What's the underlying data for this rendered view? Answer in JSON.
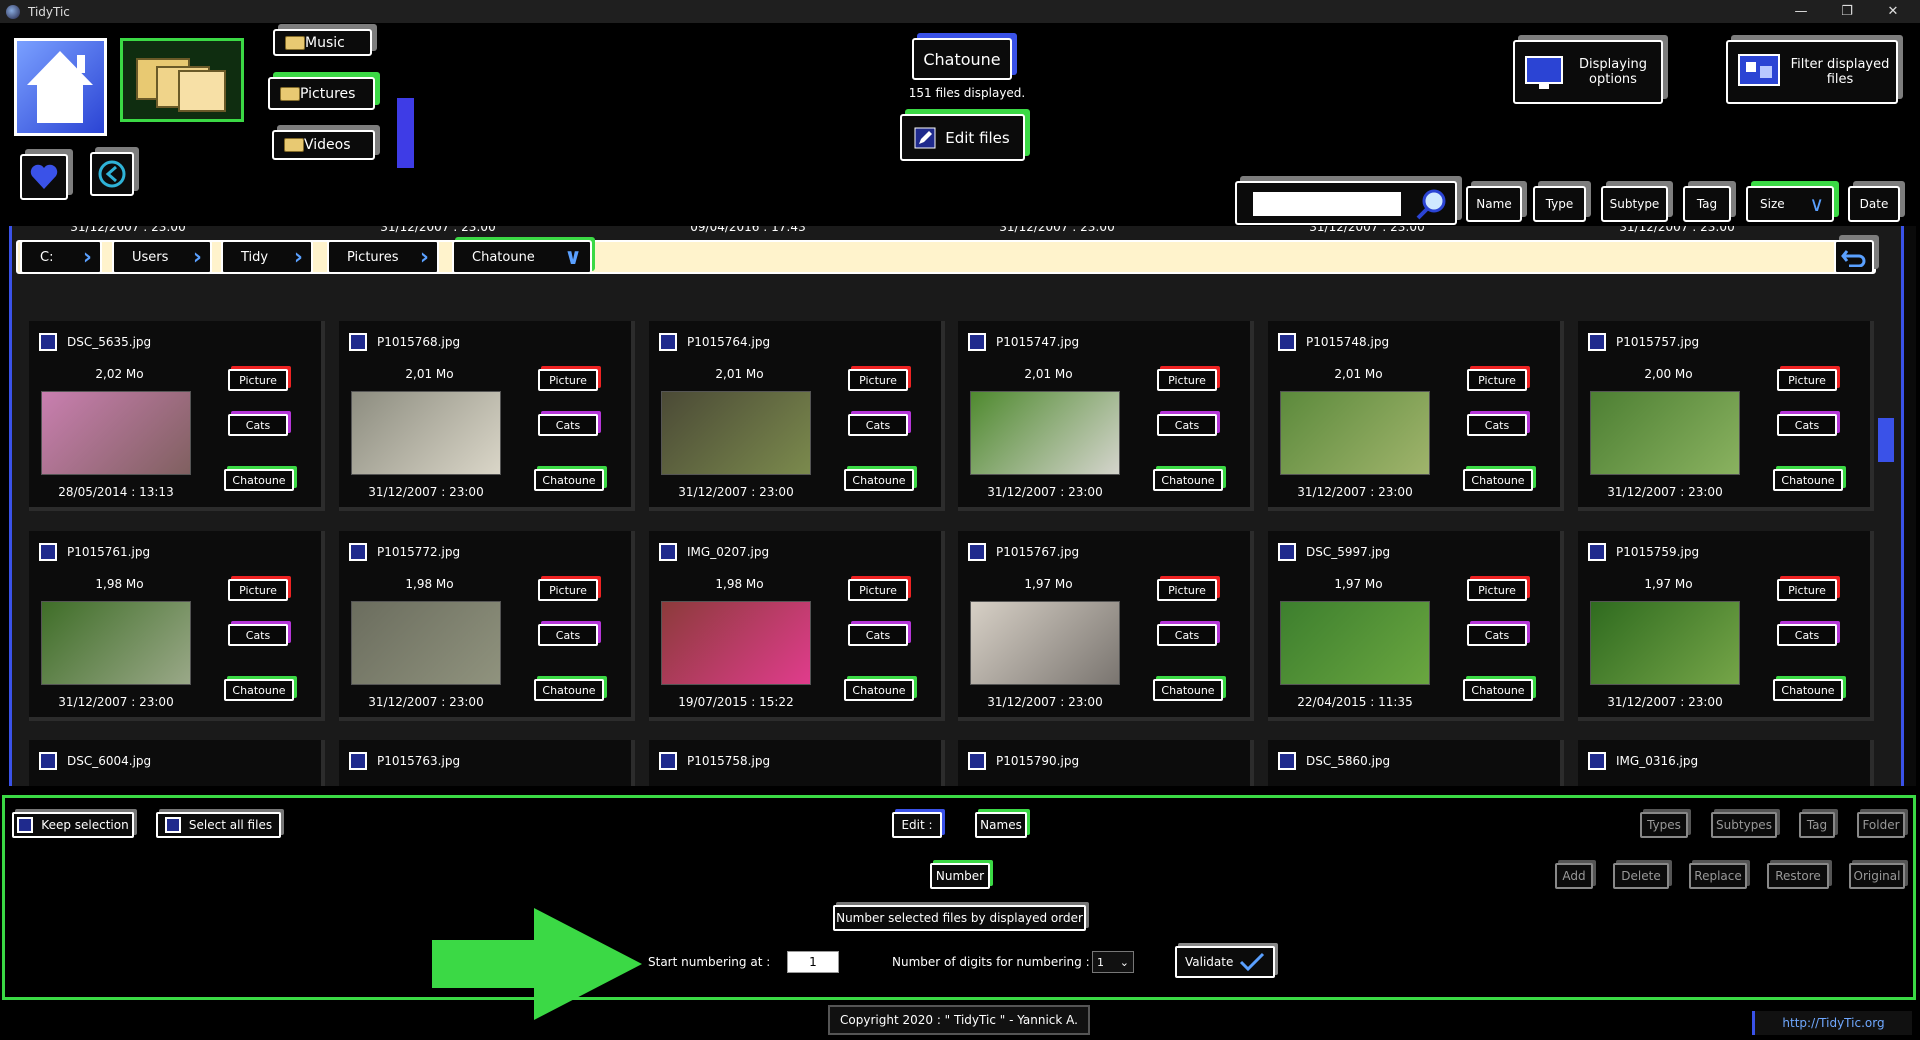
{
  "app": {
    "title": "TidyTic"
  },
  "window_controls": {
    "minimize": "—",
    "maximize": "❐",
    "close": "✕"
  },
  "nav": {
    "music": "Music",
    "pictures": "Pictures",
    "videos": "Videos"
  },
  "current_folder": {
    "name": "Chatoune",
    "count_label": "151 files displayed.",
    "edit_label": "Edit files"
  },
  "options": {
    "display": "Displaying options",
    "filter": "Filter displayed files"
  },
  "search": {
    "value": ""
  },
  "sort": {
    "name": "Name",
    "type": "Type",
    "subtype": "Subtype",
    "tag": "Tag",
    "size": "Size",
    "date": "Date"
  },
  "breadcrumb": [
    "C:",
    "Users",
    "Tidy",
    "Pictures",
    "Chatoune"
  ],
  "top_partial_dates": [
    "31/12/2007 : 23:00",
    "31/12/2007 : 23:00",
    "09/04/2016 : 17:43",
    "31/12/2007 : 23:00",
    "31/12/2007 : 23:00",
    "31/12/2007 : 23:00"
  ],
  "files_row1": [
    {
      "name": "DSC_5635.jpg",
      "size": "2,02 Mo",
      "date": "28/05/2014 : 13:13",
      "type": "Picture",
      "subtype": "Cats",
      "tag": "Chatoune"
    },
    {
      "name": "P1015768.jpg",
      "size": "2,01 Mo",
      "date": "31/12/2007 : 23:00",
      "type": "Picture",
      "subtype": "Cats",
      "tag": "Chatoune"
    },
    {
      "name": "P1015764.jpg",
      "size": "2,01 Mo",
      "date": "31/12/2007 : 23:00",
      "type": "Picture",
      "subtype": "Cats",
      "tag": "Chatoune"
    },
    {
      "name": "P1015747.jpg",
      "size": "2,01 Mo",
      "date": "31/12/2007 : 23:00",
      "type": "Picture",
      "subtype": "Cats",
      "tag": "Chatoune"
    },
    {
      "name": "P1015748.jpg",
      "size": "2,01 Mo",
      "date": "31/12/2007 : 23:00",
      "type": "Picture",
      "subtype": "Cats",
      "tag": "Chatoune"
    },
    {
      "name": "P1015757.jpg",
      "size": "2,00 Mo",
      "date": "31/12/2007 : 23:00",
      "type": "Picture",
      "subtype": "Cats",
      "tag": "Chatoune"
    }
  ],
  "files_row2": [
    {
      "name": "P1015761.jpg",
      "size": "1,98 Mo",
      "date": "31/12/2007 : 23:00",
      "type": "Picture",
      "subtype": "Cats",
      "tag": "Chatoune"
    },
    {
      "name": "P1015772.jpg",
      "size": "1,98 Mo",
      "date": "31/12/2007 : 23:00",
      "type": "Picture",
      "subtype": "Cats",
      "tag": "Chatoune"
    },
    {
      "name": "IMG_0207.jpg",
      "size": "1,98 Mo",
      "date": "19/07/2015 : 15:22",
      "type": "Picture",
      "subtype": "Cats",
      "tag": "Chatoune"
    },
    {
      "name": "P1015767.jpg",
      "size": "1,97 Mo",
      "date": "31/12/2007 : 23:00",
      "type": "Picture",
      "subtype": "Cats",
      "tag": "Chatoune"
    },
    {
      "name": "DSC_5997.jpg",
      "size": "1,97 Mo",
      "date": "22/04/2015 : 11:35",
      "type": "Picture",
      "subtype": "Cats",
      "tag": "Chatoune"
    },
    {
      "name": "P1015759.jpg",
      "size": "1,97 Mo",
      "date": "31/12/2007 : 23:00",
      "type": "Picture",
      "subtype": "Cats",
      "tag": "Chatoune"
    }
  ],
  "files_row3": [
    "DSC_6004.jpg",
    "P1015763.jpg",
    "P1015758.jpg",
    "P1015790.jpg",
    "DSC_5860.jpg",
    "IMG_0316.jpg"
  ],
  "edit_panel": {
    "keep_selection": "Keep selection",
    "select_all": "Select all files",
    "edit": "Edit :",
    "names": "Names",
    "number": "Number",
    "types": "Types",
    "subtypes": "Subtypes",
    "tag": "Tag",
    "folder": "Folder",
    "add": "Add",
    "delete": "Delete",
    "replace": "Replace",
    "restore": "Restore",
    "original": "Original",
    "number_order": "Number selected files by displayed order",
    "start_label": "Start numbering at :",
    "start_value": "1",
    "digits_label": "Number of digits for numbering :",
    "digits_value": "1",
    "validate": "Validate"
  },
  "footer": {
    "copyright": "Copyright 2020 : \" TidyTic \" - Yannick A.",
    "link": "http://TidyTic.org"
  },
  "colors": {
    "green": "#3bd945",
    "blue": "#3a52e8",
    "red": "#e22222",
    "magenta": "#b536d8"
  }
}
